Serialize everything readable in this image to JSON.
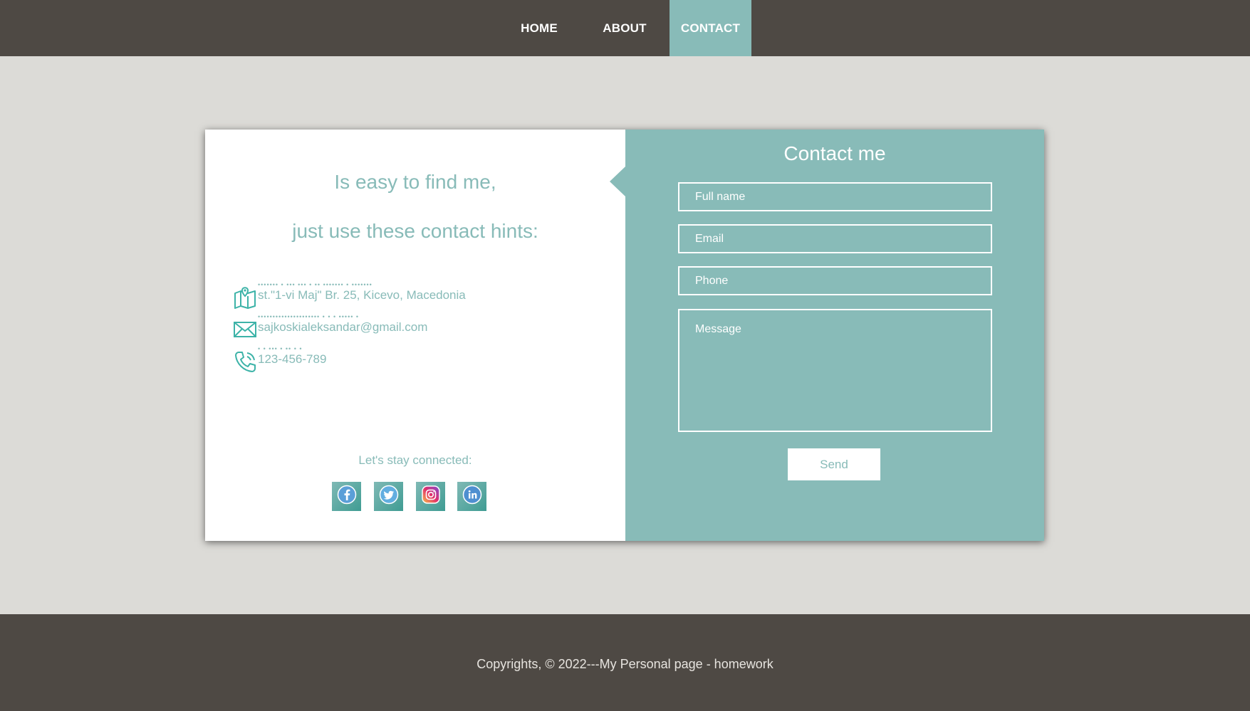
{
  "nav": {
    "items": [
      {
        "label": "HOME",
        "active": false
      },
      {
        "label": "ABOUT",
        "active": false
      },
      {
        "label": "CONTACT",
        "active": true
      }
    ]
  },
  "colors": {
    "nav_bg": "#4e4944",
    "page_bg": "#dcdbd7",
    "accent": "#88bbb8",
    "white": "#ffffff"
  },
  "contact_info": {
    "intro_line_1": "Is easy to find me,",
    "intro_line_2": "just use these contact hints:",
    "hints": [
      {
        "icon": "map-icon",
        "text": "st.\"1-vi Maj\" Br. 25, Kicevo, Macedonia"
      },
      {
        "icon": "envelope-icon",
        "text": "sajkoskialeksandar@gmail.com"
      },
      {
        "icon": "phone-icon",
        "text": "123-456-789"
      }
    ],
    "stay_connected": "Let's stay connected:",
    "socials": [
      "facebook-icon",
      "twitter-icon",
      "instagram-icon",
      "linkedin-icon"
    ]
  },
  "form": {
    "title": "Contact me",
    "fullname_placeholder": "Full name",
    "email_placeholder": "Email",
    "phone_placeholder": "Phone",
    "message_placeholder": "Message",
    "send_label": "Send"
  },
  "footer": {
    "text": "Copyrights, © 2022---My Personal page - homework"
  }
}
